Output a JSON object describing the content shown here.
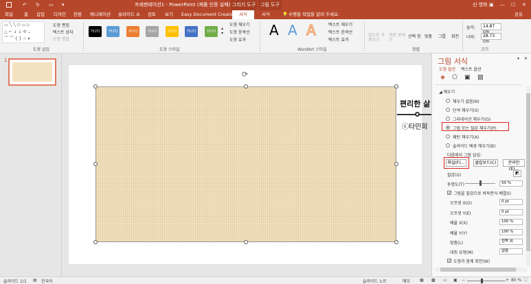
{
  "titlebar": {
    "title": "프레젠테이션1 - PowerPoint (제품 인증 실패)",
    "ctx_drawing": "그리기 도구",
    "ctx_picture": "그림 도구",
    "user": "신 영화"
  },
  "tabs": [
    {
      "label": "파일"
    },
    {
      "label": "홈"
    },
    {
      "label": "삽입"
    },
    {
      "label": "디자인"
    },
    {
      "label": "전환"
    },
    {
      "label": "애니메이션"
    },
    {
      "label": "슬라이드 쇼"
    },
    {
      "label": "검토"
    },
    {
      "label": "보기"
    },
    {
      "label": "Easy Document Creator"
    },
    {
      "label": "서식"
    },
    {
      "label": "서식"
    }
  ],
  "tell_me": "수행할 작업을 알려 주세요.",
  "share": "공유",
  "ribbon": {
    "shape_insert": {
      "label": "도형 삽입",
      "edit_shape": "도형 편집",
      "text_box": "텍스트 상자",
      "merge_shapes": "도형 병합"
    },
    "shape_styles": {
      "label": "도형 스타일",
      "sample_text": "가나다",
      "colors": [
        "#000000",
        "#5b9bd5",
        "#ed7d31",
        "#a5a5a5",
        "#ffc000",
        "#4472c4",
        "#70ad47"
      ],
      "fill": "도형 채우기",
      "outline": "도형 윤곽선",
      "effects": "도형 효과"
    },
    "wordart": {
      "label": "WordArt 스타일",
      "sample": "A",
      "text_fill": "텍스트 채우기",
      "text_outline": "텍스트 윤곽선",
      "text_effects": "텍스트 효과"
    },
    "arrange": {
      "label": "정렬",
      "bring_forward": "앞으로 가져오기",
      "send_backward": "뒤로 보내기",
      "selection_pane": "선택 창",
      "align": "맞춤",
      "group": "그룹",
      "rotate": "회전"
    },
    "size": {
      "label": "크기",
      "height_label": "높이:",
      "height": "14.87 cm",
      "width_label": "너비:",
      "width": "28.73 cm"
    }
  },
  "thumbnail": {
    "number": "1"
  },
  "slide": {
    "watermark_title": "편리한 삶",
    "watermark_author": "ⓒ타민희"
  },
  "format_pane": {
    "title": "그림 서식",
    "tab_shape_options": "도형 옵션",
    "tab_text_options": "텍스트 옵션",
    "section_fill": "채우기",
    "fill_options": [
      {
        "label": "채우기 없음(N)",
        "selected": false
      },
      {
        "label": "단색 채우기(S)",
        "selected": false
      },
      {
        "label": "그라데이션 채우기(G)",
        "selected": false
      },
      {
        "label": "그림 또는 질감 채우기(P)",
        "selected": true
      },
      {
        "label": "패턴 채우기(A)",
        "selected": false
      },
      {
        "label": "슬라이드 배경 채우기(B)",
        "selected": false
      }
    ],
    "insert_picture_from": "다음에서 그림 삽입:",
    "btn_file": "파일(F)...",
    "btn_clipboard": "클립보드(C)",
    "btn_online": "온라인(E)...",
    "texture_label": "질감(U)",
    "transparency_label": "투명도(T)",
    "transparency_value": "50 %",
    "transparency_level": 0.5,
    "tile_checkbox": "그림을 질감으로 바둑판식 배열(I)",
    "offset_x_label": "오프셋 X(O)",
    "offset_x": "0 pt",
    "offset_y_label": "오프셋 Y(E)",
    "offset_y": "0 pt",
    "scale_x_label": "배율 X(X)",
    "scale_x": "100 %",
    "scale_y_label": "배율 Y(Y)",
    "scale_y": "100 %",
    "alignment_label": "맞춤(L)",
    "alignment_value": "왼쪽 위",
    "mirror_label": "대칭 유형(M)",
    "mirror_value": "없음",
    "rotate_with_shape": "도형과 함께 회전(W)"
  },
  "status": {
    "slide_info": "슬라이드 1/1",
    "language": "한국어",
    "notes": "슬라이드 노트",
    "comments": "메모",
    "zoom": "80 %"
  },
  "accent": "#b7472a"
}
